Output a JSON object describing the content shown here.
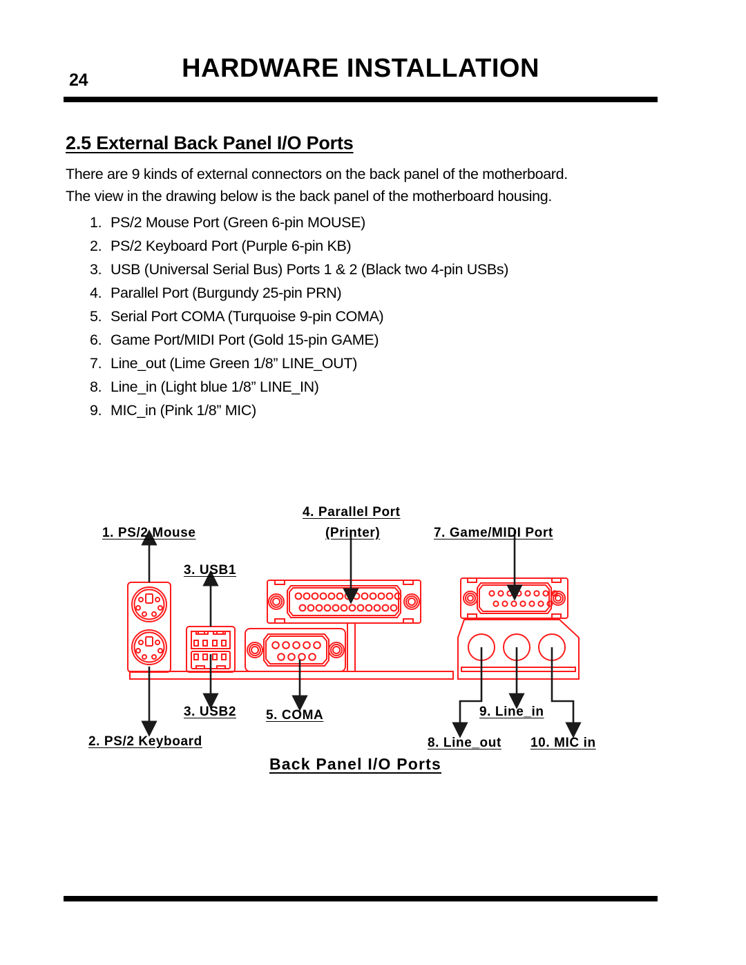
{
  "header": {
    "page_number": "24",
    "title": "HARDWARE INSTALLATION"
  },
  "section": {
    "heading": "2.5  External Back Panel I/O Ports",
    "paragraphs": [
      "There are 9 kinds of external connectors on the back panel of the motherboard.",
      "The view in the drawing below is the back panel of the motherboard housing."
    ],
    "items": [
      {
        "num": "1.",
        "text": "PS/2 Mouse Port (Green 6-pin MOUSE)"
      },
      {
        "num": "2.",
        "text": "PS/2 Keyboard Port (Purple 6-pin KB)"
      },
      {
        "num": "3.",
        "text": "USB (Universal Serial Bus) Ports 1 & 2 (Black two 4-pin USBs)"
      },
      {
        "num": "4.",
        "text": "Parallel Port (Burgundy 25-pin PRN)"
      },
      {
        "num": "5.",
        "text": "Serial Port COMA (Turquoise 9-pin COMA)"
      },
      {
        "num": "6.",
        "text": "Game Port/MIDI Port (Gold 15-pin GAME)"
      },
      {
        "num": "7.",
        "text": "Line_out (Lime Green 1/8” LINE_OUT)"
      },
      {
        "num": "8.",
        "text": "Line_in (Light blue 1/8” LINE_IN)"
      },
      {
        "num": "9.",
        "text": "MIC_in (Pink 1/8” MIC)"
      }
    ]
  },
  "diagram": {
    "caption": "Back Panel I/O Ports",
    "labels": {
      "ps2_mouse": "1. PS/2 Mouse",
      "usb1": "3. USB1",
      "parallel_port_line1": "4. Parallel Port",
      "parallel_port_line2": "(Printer)",
      "game_midi": "7. Game/MIDI Port",
      "ps2_keyboard": "2. PS/2 Keyboard",
      "usb2": "3. USB2",
      "coma": "5. COMA",
      "line_out": "8. Line_out",
      "line_in": "9. Line_in",
      "mic_in": "10. MIC in"
    },
    "colors": {
      "outline": "#ff1a1a",
      "screw_center": "#1414d2",
      "arrow": "#1a1a1a"
    },
    "connector_pins": {
      "ps2_holes": 6,
      "usb_contacts": 4,
      "parallel_top_pins": 13,
      "parallel_bottom_pins": 12,
      "serial_top_pins": 5,
      "serial_bottom_pins": 4,
      "game_top_pins": 8,
      "game_bottom_pins": 7,
      "audio_jacks": 3
    }
  }
}
